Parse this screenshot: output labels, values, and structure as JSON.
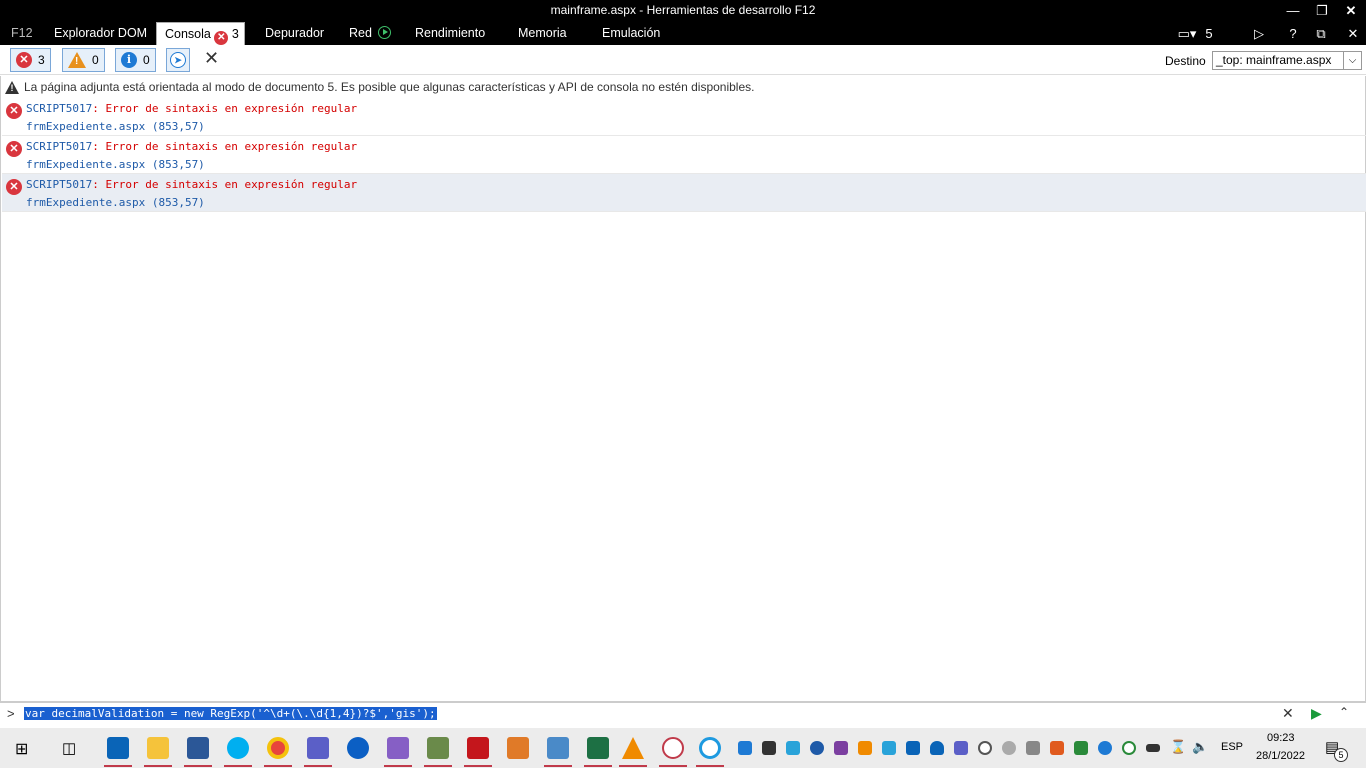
{
  "window": {
    "title": "mainframe.aspx - Herramientas de desarrollo F12"
  },
  "tabs": [
    {
      "label": "F12"
    },
    {
      "label": "Explorador DOM"
    },
    {
      "label": "Consola",
      "count": "3"
    },
    {
      "label": "Depurador"
    },
    {
      "label": "Red"
    },
    {
      "label": "Rendimiento"
    },
    {
      "label": "Memoria"
    },
    {
      "label": "Emulación"
    }
  ],
  "toolbar_right": {
    "device_count": "5"
  },
  "filters": {
    "errors": "3",
    "warnings": "0",
    "info": "0"
  },
  "destino": {
    "label": "Destino",
    "value": "_top: mainframe.aspx"
  },
  "console": {
    "info_message": "La página adjunta está orientada al modo de documento 5. Es posible que algunas características y API de consola no estén disponibles.",
    "messages": [
      {
        "id": "SCRIPT5017",
        "text": ": Error de sintaxis en expresión regular",
        "source": "frmExpediente.aspx (853,57)"
      },
      {
        "id": "SCRIPT5017",
        "text": ": Error de sintaxis en expresión regular",
        "source": "frmExpediente.aspx (853,57)"
      },
      {
        "id": "SCRIPT5017",
        "text": ": Error de sintaxis en expresión regular",
        "source": "frmExpediente.aspx (853,57)"
      }
    ]
  },
  "input": {
    "prompt": ">",
    "command": "var decimalValidation = new RegExp('^\\d+(\\.\\d{1,4})?$','gis');"
  },
  "taskbar": {
    "language": "ESP",
    "time": "09:23",
    "date": "28/1/2022",
    "notifications": "5"
  },
  "colors": {
    "error": "#d9363e",
    "warning": "#e8911e",
    "info": "#1e7ad4",
    "link": "#1e5aa8",
    "error_text": "#d40000"
  }
}
